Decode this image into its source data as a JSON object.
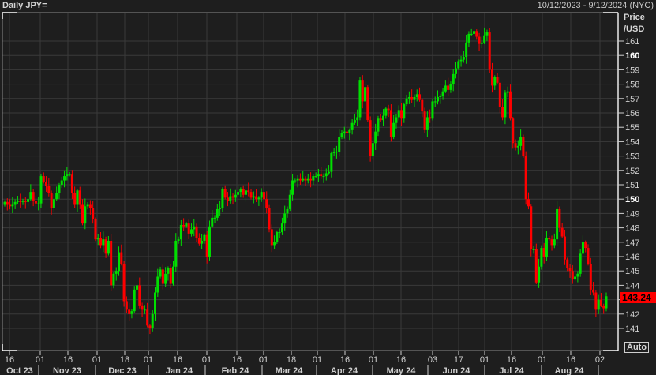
{
  "header": {
    "title": "Daily JPY=",
    "date_range": "10/12/2023 - 9/12/2024 (NYC)"
  },
  "axis": {
    "unit_line1": "Price",
    "unit_line2": "/USD",
    "auto_label": "Auto",
    "last_price": "143.24"
  },
  "colors": {
    "up": "#00e000",
    "down": "#ff0000",
    "background": "#1e1e1e",
    "grid": "#3a3a3a",
    "last_price_bg": "#ff0000"
  },
  "chart_data": {
    "type": "candlestick",
    "title": "Daily JPY=",
    "ylabel": "Price /USD",
    "ylim": [
      140,
      162
    ],
    "yticks": [
      141,
      142,
      143,
      144,
      145,
      146,
      147,
      148,
      149,
      150,
      151,
      152,
      153,
      154,
      155,
      156,
      157,
      158,
      159,
      160,
      161
    ],
    "bold_yticks": [
      150,
      160
    ],
    "grid": true,
    "xticks": [
      "16",
      "01",
      "16",
      "01",
      "18",
      "01",
      "16",
      "01",
      "16",
      "01",
      "18",
      "01",
      "16",
      "01",
      "16",
      "03",
      "17",
      "01",
      "16",
      "01",
      "16",
      "02"
    ],
    "months": [
      "Oct 23",
      "Nov 23",
      "Dec 23",
      "Jan 24",
      "Feb 24",
      "Mar 24",
      "Apr 24",
      "May 24",
      "Jun 24",
      "Jul 24",
      "Aug 24"
    ],
    "first_open": 149.6,
    "close": [
      149.8,
      149.6,
      149.5,
      149.6,
      149.8,
      149.9,
      149.8,
      149.9,
      149.8,
      150.0,
      150.5,
      149.9,
      149.7,
      149.7,
      151.6,
      151.2,
      150.9,
      150.4,
      149.4,
      150.0,
      150.4,
      151.0,
      151.3,
      151.6,
      151.7,
      151.7,
      150.4,
      149.6,
      150.6,
      149.6,
      148.3,
      149.5,
      149.6,
      149.4,
      148.6,
      147.2,
      147.3,
      146.8,
      147.2,
      146.2,
      147.1,
      144.0,
      144.8,
      145.0,
      146.3,
      145.5,
      142.9,
      142.3,
      142.0,
      142.2,
      143.7,
      144.0,
      142.6,
      142.3,
      142.3,
      141.2,
      141.0,
      142.0,
      143.5,
      144.6,
      145.1,
      144.1,
      144.8,
      145.2,
      144.1,
      145.3,
      147.1,
      147.2,
      148.2,
      148.1,
      148.3,
      147.6,
      147.9,
      148.1,
      147.3,
      146.9,
      147.1,
      147.5,
      146.0,
      148.1,
      148.7,
      148.7,
      149.3,
      149.4,
      150.7,
      150.1,
      149.9,
      150.2,
      150.1,
      150.3,
      150.5,
      150.7,
      150.3,
      150.6,
      150.5,
      150.1,
      150.2,
      150.0,
      150.1,
      150.5,
      150.0,
      149.4,
      147.9,
      146.8,
      147.0,
      147.7,
      147.7,
      148.3,
      149.0,
      149.3,
      150.3,
      151.3,
      151.3,
      151.4,
      151.3,
      151.4,
      151.3,
      151.4,
      151.3,
      151.6,
      151.6,
      151.7,
      151.6,
      151.6,
      151.8,
      151.9,
      153.2,
      153.3,
      153.3,
      154.3,
      154.6,
      154.7,
      154.6,
      154.8,
      155.3,
      155.5,
      155.7,
      158.3,
      156.8,
      157.8,
      155.5,
      153.0,
      153.9,
      154.7,
      155.6,
      155.5,
      155.8,
      156.3,
      156.2,
      154.3,
      155.3,
      155.7,
      156.2,
      155.6,
      156.6,
      157.0,
      157.1,
      156.9,
      157.1,
      157.3,
      156.9,
      156.1,
      154.8,
      155.7,
      155.6,
      156.8,
      156.8,
      157.1,
      157.2,
      157.5,
      157.9,
      157.6,
      158.0,
      158.7,
      159.1,
      159.6,
      159.7,
      159.9,
      160.9,
      161.5,
      161.5,
      161.7,
      161.3,
      160.8,
      160.9,
      161.4,
      161.6,
      159.0,
      157.9,
      158.5,
      158.1,
      156.4,
      155.7,
      157.4,
      157.5,
      155.6,
      153.9,
      153.6,
      153.7,
      154.3,
      153.0,
      150.0,
      149.5,
      146.5,
      146.5,
      144.2,
      145.3,
      146.6,
      146.0,
      147.3,
      147.2,
      146.8,
      147.2,
      149.3,
      148.0,
      147.4,
      145.8,
      145.2,
      145.0,
      144.4,
      144.6,
      144.8,
      146.2,
      147.0,
      146.6,
      145.5,
      143.7,
      143.5,
      142.3,
      143.0,
      142.6,
      142.4,
      143.24
    ]
  }
}
